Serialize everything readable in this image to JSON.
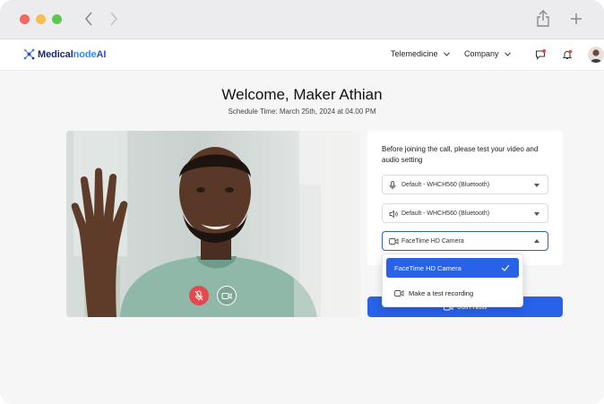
{
  "brand": {
    "name_part1": "Medical",
    "name_part2": "node",
    "name_part3": "AI"
  },
  "nav": {
    "items": [
      {
        "label": "Telemedicine"
      },
      {
        "label": "Company"
      }
    ]
  },
  "page": {
    "title": "Welcome, Maker Athian",
    "schedule": "Schedule Time: March 25th, 2024 at 04.00 PM"
  },
  "setup": {
    "prompt": "Before joining the call, please  test your video and audio setting",
    "microphone": {
      "value": "Default - WHCH560 (Bluetooth)",
      "icon": "microphone-icon"
    },
    "speaker": {
      "value": "Default - WHCH560 (Bluetooth)",
      "icon": "speaker-icon"
    },
    "camera": {
      "value": "FaceTime HD Camera",
      "icon": "camera-icon"
    },
    "camera_options": [
      {
        "label": "FaceTime HD Camera",
        "selected": true
      },
      {
        "label": "Make a test recording",
        "selected": false
      }
    ],
    "join_label": "Join Now"
  },
  "colors": {
    "accent": "#2762e8",
    "mute": "#e5484d",
    "brand": "#2a4fd6"
  }
}
